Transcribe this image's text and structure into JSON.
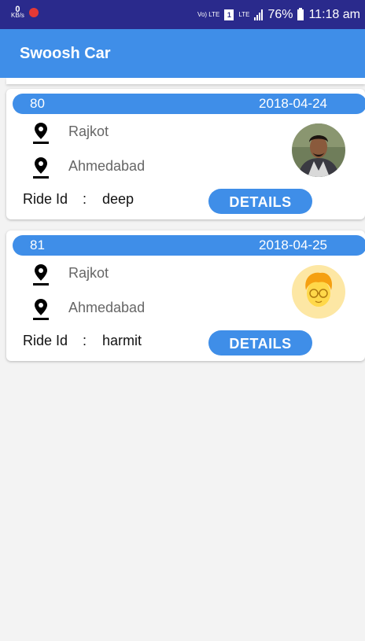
{
  "status_bar": {
    "speed_value": "0",
    "speed_unit": "KB/s",
    "volte_label": "Vo) LTE",
    "sim_label": "1",
    "lte_label": "LTE",
    "battery_percent": "76%",
    "time": "11:18 am"
  },
  "app_bar": {
    "title": "Swoosh Car"
  },
  "rides": [
    {
      "id": "80",
      "date": "2018-04-24",
      "from": "Rajkot",
      "to": "Ahmedabad",
      "ride_id_label": "Ride Id",
      "ride_id_sep": ":",
      "ride_id_value": "deep",
      "details_label": "DETAILS",
      "avatar_icon": "user-photo-avatar"
    },
    {
      "id": "81",
      "date": "2018-04-25",
      "from": "Rajkot",
      "to": "Ahmedabad",
      "ride_id_label": "Ride Id",
      "ride_id_sep": ":",
      "ride_id_value": "harmit",
      "details_label": "DETAILS",
      "avatar_icon": "cartoon-boy-avatar"
    }
  ],
  "colors": {
    "primary": "#3f8ee8",
    "status_bar": "#2a2a8c",
    "background": "#f3f3f3"
  }
}
